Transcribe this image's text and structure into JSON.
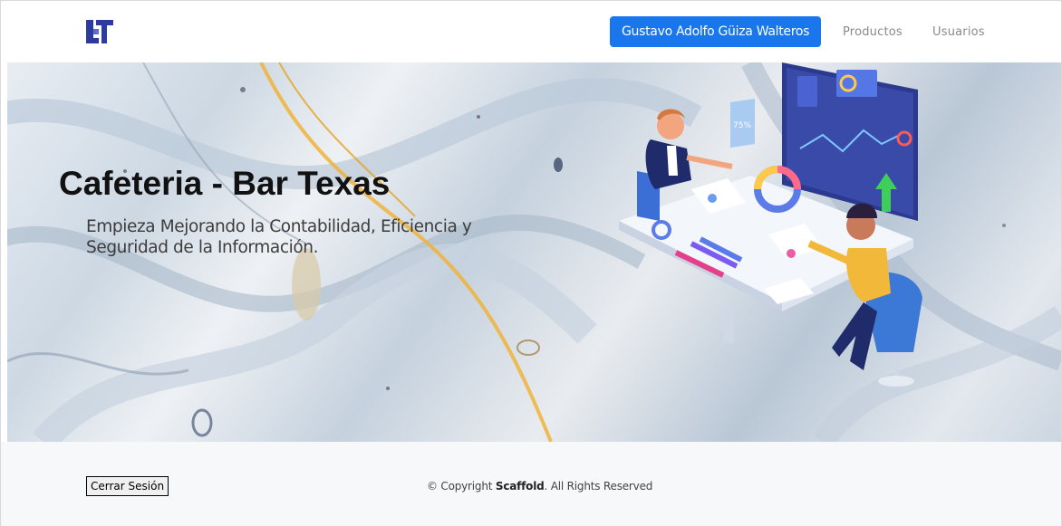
{
  "navbar": {
    "logo_icon": "brand-logo-icon",
    "user_button_label": "Gustavo Adolfo Güiza Walteros",
    "links": [
      {
        "label": "Productos"
      },
      {
        "label": "Usuarios"
      }
    ],
    "accent_color": "#1a76ec",
    "logo_color": "#2d3a9e"
  },
  "hero": {
    "title": "Cafeteria - Bar Texas",
    "subtitle": "Empieza Mejorando la Contabilidad, Eficiencia y Seguridad de la Información.",
    "illustration_icon": "business-analytics-illustration",
    "illustration_percent_label": "75%"
  },
  "footer": {
    "logout_label": "Cerrar Sesión",
    "copyright_prefix": "© Copyright ",
    "copyright_brand": "Scaffold",
    "copyright_suffix": ". All Rights Reserved",
    "background": "#f6f8f9"
  }
}
